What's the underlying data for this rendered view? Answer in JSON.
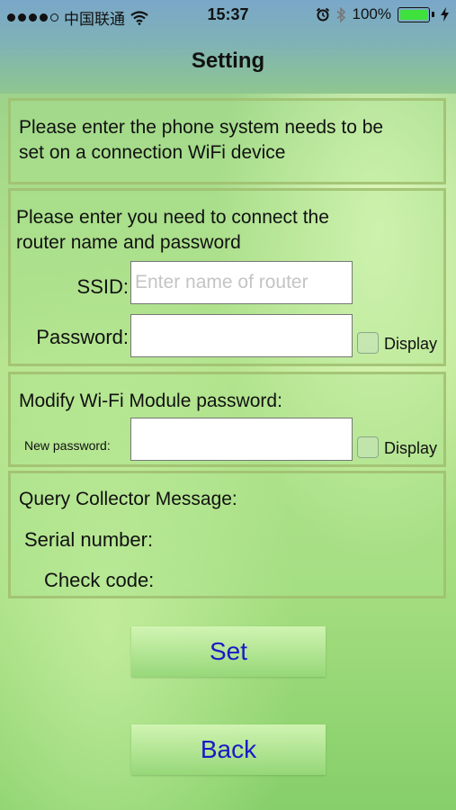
{
  "status_bar": {
    "carrier": "中国联通",
    "time": "15:37",
    "battery": "100%"
  },
  "nav": {
    "title": "Setting"
  },
  "panel_intro": {
    "line1": "Please enter the phone system needs to be",
    "line2": "set on a connection WiFi device"
  },
  "router": {
    "line1": "Please enter you need to connect the",
    "line2": "router name and password",
    "ssid_label": "SSID:",
    "ssid_value": "",
    "ssid_placeholder": "Enter name of router",
    "password_label": "Password:",
    "password_value": "",
    "display_label": "Display"
  },
  "module": {
    "heading": "Modify Wi-Fi Module password:",
    "new_password_label": "New password:",
    "new_password_value": "",
    "display_label": "Display"
  },
  "collector": {
    "heading": "Query Collector Message:",
    "serial_label": "Serial number:",
    "check_label": "Check code:"
  },
  "buttons": {
    "set": "Set",
    "back": "Back"
  },
  "icons": [
    "signal-dots-icon",
    "wifi-icon",
    "alarm-icon",
    "bluetooth-icon",
    "battery-icon",
    "charging-bolt-icon"
  ],
  "colors": {
    "button_text": "#1a19c8",
    "battery_fill": "#3fe23c"
  }
}
